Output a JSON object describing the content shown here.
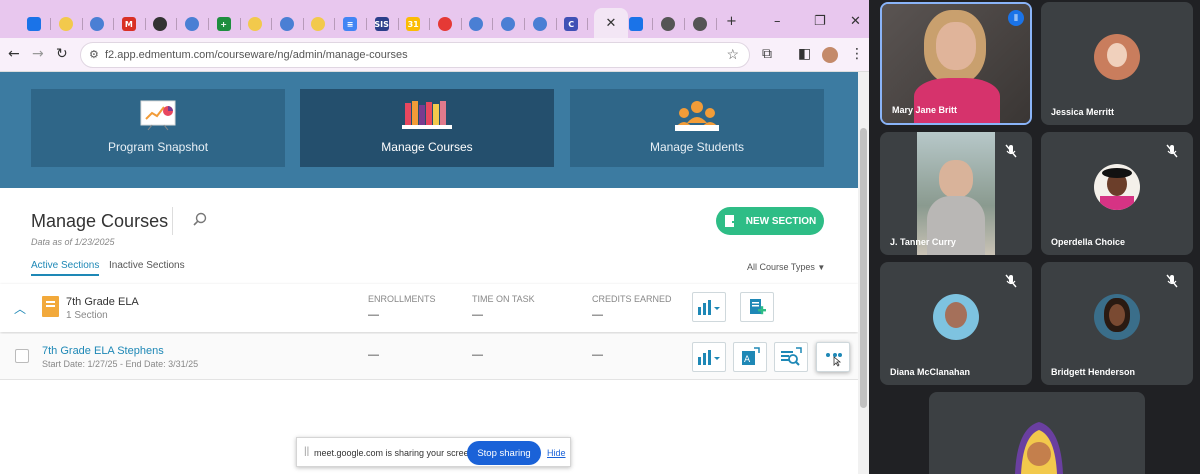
{
  "browser": {
    "url": "f2.app.edmentum.com/courseware/ng/admin/manage-courses",
    "active_tab_icon": "close-icon",
    "tabs": [
      {
        "icon": "google-drive-icon",
        "color": "#1a73e8"
      },
      {
        "icon": "edmentum-icon",
        "color": "#f2c94c"
      },
      {
        "icon": "chrome-app-icon",
        "color": "#4a7fd4"
      },
      {
        "icon": "gmail-icon",
        "color": "#d93025"
      },
      {
        "icon": "clever-icon",
        "color": "#333333"
      },
      {
        "icon": "chrome-app-icon",
        "color": "#4a7fd4"
      },
      {
        "icon": "google-sheets-icon",
        "color": "#1e8e3e"
      },
      {
        "icon": "edmentum-icon",
        "color": "#f2c94c"
      },
      {
        "icon": "chrome-app-icon",
        "color": "#4a7fd4"
      },
      {
        "icon": "edmentum-icon",
        "color": "#f2c94c"
      },
      {
        "icon": "google-docs-icon",
        "color": "#4285f4"
      },
      {
        "icon": "sis-icon",
        "color": "#2a3f8a"
      },
      {
        "icon": "calendar-icon",
        "color": "#fbbc04"
      },
      {
        "icon": "record-icon",
        "color": "#e53935"
      },
      {
        "icon": "chrome-app-icon",
        "color": "#4a7fd4"
      },
      {
        "icon": "chrome-app-icon",
        "color": "#4a7fd4"
      },
      {
        "icon": "chrome-app-icon",
        "color": "#4a7fd4"
      },
      {
        "icon": "canvas-icon",
        "color": "#3f51b5"
      }
    ],
    "tabs_after": [
      {
        "icon": "google-drive-icon",
        "color": "#1a73e8"
      },
      {
        "icon": "chrome-icon",
        "color": "#555555"
      },
      {
        "icon": "chrome-icon",
        "color": "#555555"
      }
    ],
    "new_tab": "+"
  },
  "hero": {
    "cards": [
      {
        "label": "Program Snapshot",
        "icon": "chart-board-icon"
      },
      {
        "label": "Manage Courses",
        "icon": "books-icon"
      },
      {
        "label": "Manage Students",
        "icon": "students-icon"
      }
    ]
  },
  "header": {
    "title": "Manage Courses",
    "data_as_of": "Data as of 1/23/2025",
    "new_section": "NEW SECTION"
  },
  "tabs": {
    "active": "Active Sections",
    "inactive": "Inactive Sections"
  },
  "filter": {
    "label": "All Course Types"
  },
  "columns": [
    "ENROLLMENTS",
    "TIME ON TASK",
    "CREDITS EARNED"
  ],
  "course": {
    "name": "7th Grade ELA",
    "count": "1 Section",
    "dashes": [
      "—",
      "—",
      "—"
    ]
  },
  "section": {
    "name": "7th Grade ELA Stephens",
    "dates": "Start Date: 1/27/25 - End Date: 3/31/25",
    "dashes": [
      "—",
      "—",
      "—"
    ]
  },
  "share": {
    "text": "meet.google.com is sharing your screen.",
    "stop": "Stop sharing",
    "hide": "Hide"
  },
  "participants": [
    {
      "name": "Mary Jane Britt"
    },
    {
      "name": "Jessica Merritt"
    },
    {
      "name": "J. Tanner Curry"
    },
    {
      "name": "Operdella Choice"
    },
    {
      "name": "Diana McClanahan"
    },
    {
      "name": "Bridgett Henderson"
    }
  ],
  "colors": {
    "hero": "#3c7ba1",
    "accent": "#1e88b6",
    "green": "#2ebd86",
    "meet_tile": "#3c4043",
    "speaking": "#8ab4f8"
  }
}
